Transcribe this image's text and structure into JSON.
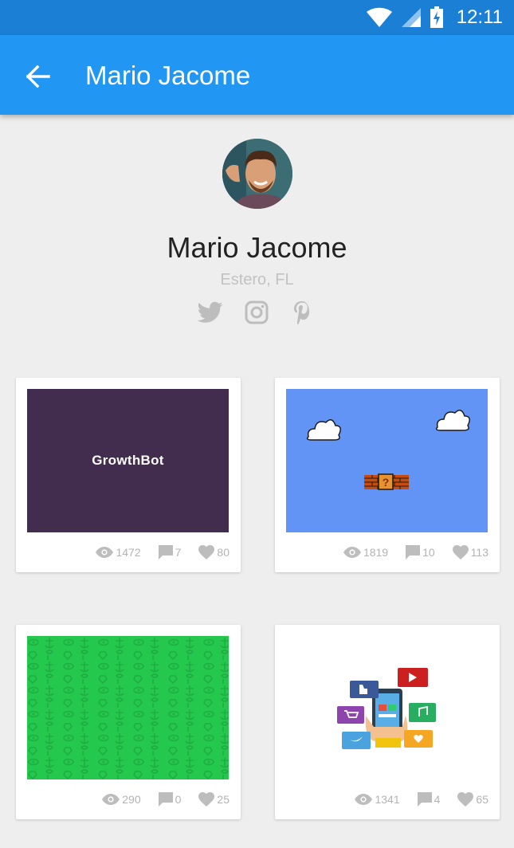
{
  "status_bar": {
    "time": "12:11"
  },
  "app_bar": {
    "title": "Mario Jacome"
  },
  "profile": {
    "name": "Mario Jacome",
    "location": "Estero, FL"
  },
  "socials": [
    "twitter-icon",
    "instagram-icon",
    "pinterest-icon"
  ],
  "cards": [
    {
      "image_text": "GrowthBot",
      "views": "1472",
      "comments": "7",
      "likes": "80"
    },
    {
      "views": "1819",
      "comments": "10",
      "likes": "113"
    },
    {
      "views": "290",
      "comments": "0",
      "likes": "25"
    },
    {
      "views": "1341",
      "comments": "4",
      "likes": "65"
    }
  ],
  "colors": {
    "app_bar": "#2196f3",
    "status_bar": "#1b7fd6",
    "background": "#eeeeee",
    "growthbot": "#422d4e",
    "mario_sky": "#6294f6",
    "pattern_green": "#23c84c"
  }
}
